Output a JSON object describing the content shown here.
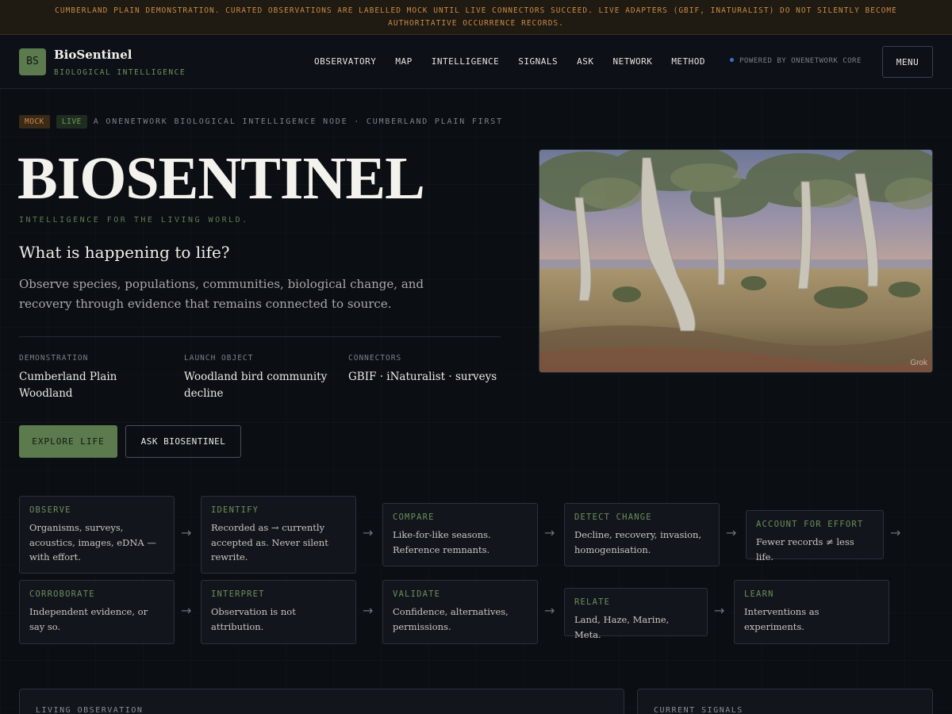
{
  "banner": {
    "text": "CUMBERLAND PLAIN DEMONSTRATION. CURATED OBSERVATIONS ARE LABELLED MOCK UNTIL LIVE CONNECTORS SUCCEED. LIVE ADAPTERS (GBIF, INATURALIST) DO NOT SILENTLY BECOME AUTHORITATIVE OCCURRENCE RECORDS."
  },
  "brand": {
    "logo": "BS",
    "name": "BioSentinel",
    "subtitle": "BIOLOGICAL INTELLIGENCE"
  },
  "nav": {
    "items": [
      "OBSERVATORY",
      "MAP",
      "INTELLIGENCE",
      "SIGNALS",
      "ASK",
      "NETWORK",
      "METHOD"
    ],
    "powered": "POWERED BY ONENETWORK CORE",
    "menu": "MENU"
  },
  "hero": {
    "tag_mock": "MOCK",
    "tag_live": "LIVE",
    "tag_text": "A ONENETWORK BIOLOGICAL INTELLIGENCE NODE · CUMBERLAND PLAIN FIRST",
    "title": "BIOSENTINEL",
    "tagline": "INTELLIGENCE FOR THE LIVING WORLD.",
    "question": "What is happening to life?",
    "description": "Observe species, populations, communities, biological change, and recovery through evidence that remains connected to source.",
    "meta": [
      {
        "label": "DEMONSTRATION",
        "value": "Cumberland Plain Woodland"
      },
      {
        "label": "LAUNCH OBJECT",
        "value": "Woodland bird community decline"
      },
      {
        "label": "CONNECTORS",
        "value": "GBIF · iNaturalist · surveys"
      }
    ],
    "primary_button": "EXPLORE LIFE",
    "secondary_button": "ASK BIOSENTINEL",
    "image_watermark": "Grok"
  },
  "flow": {
    "row1": [
      {
        "title": "OBSERVE",
        "desc": "Organisms, surveys, acoustics, images, eDNA — with effort."
      },
      {
        "title": "IDENTIFY",
        "desc": "Recorded as → currently accepted as. Never silent rewrite."
      },
      {
        "title": "COMPARE",
        "desc": "Like-for-like seasons. Reference remnants."
      },
      {
        "title": "DETECT CHANGE",
        "desc": "Decline, recovery, invasion, homogenisation."
      },
      {
        "title": "ACCOUNT FOR EFFORT",
        "desc": "Fewer records ≠ less life."
      }
    ],
    "row2": [
      {
        "title": "CORROBORATE",
        "desc": "Independent evidence, or say so."
      },
      {
        "title": "INTERPRET",
        "desc": "Observation is not attribution."
      },
      {
        "title": "VALIDATE",
        "desc": "Confidence, alternatives, permissions."
      },
      {
        "title": "RELATE",
        "desc": "Land, Haze, Marine, Meta."
      },
      {
        "title": "LEARN",
        "desc": "Interventions as experiments."
      }
    ],
    "arrow": "→"
  },
  "panels": {
    "living": "LIVING OBSERVATION",
    "signals": "CURRENT SIGNALS"
  }
}
